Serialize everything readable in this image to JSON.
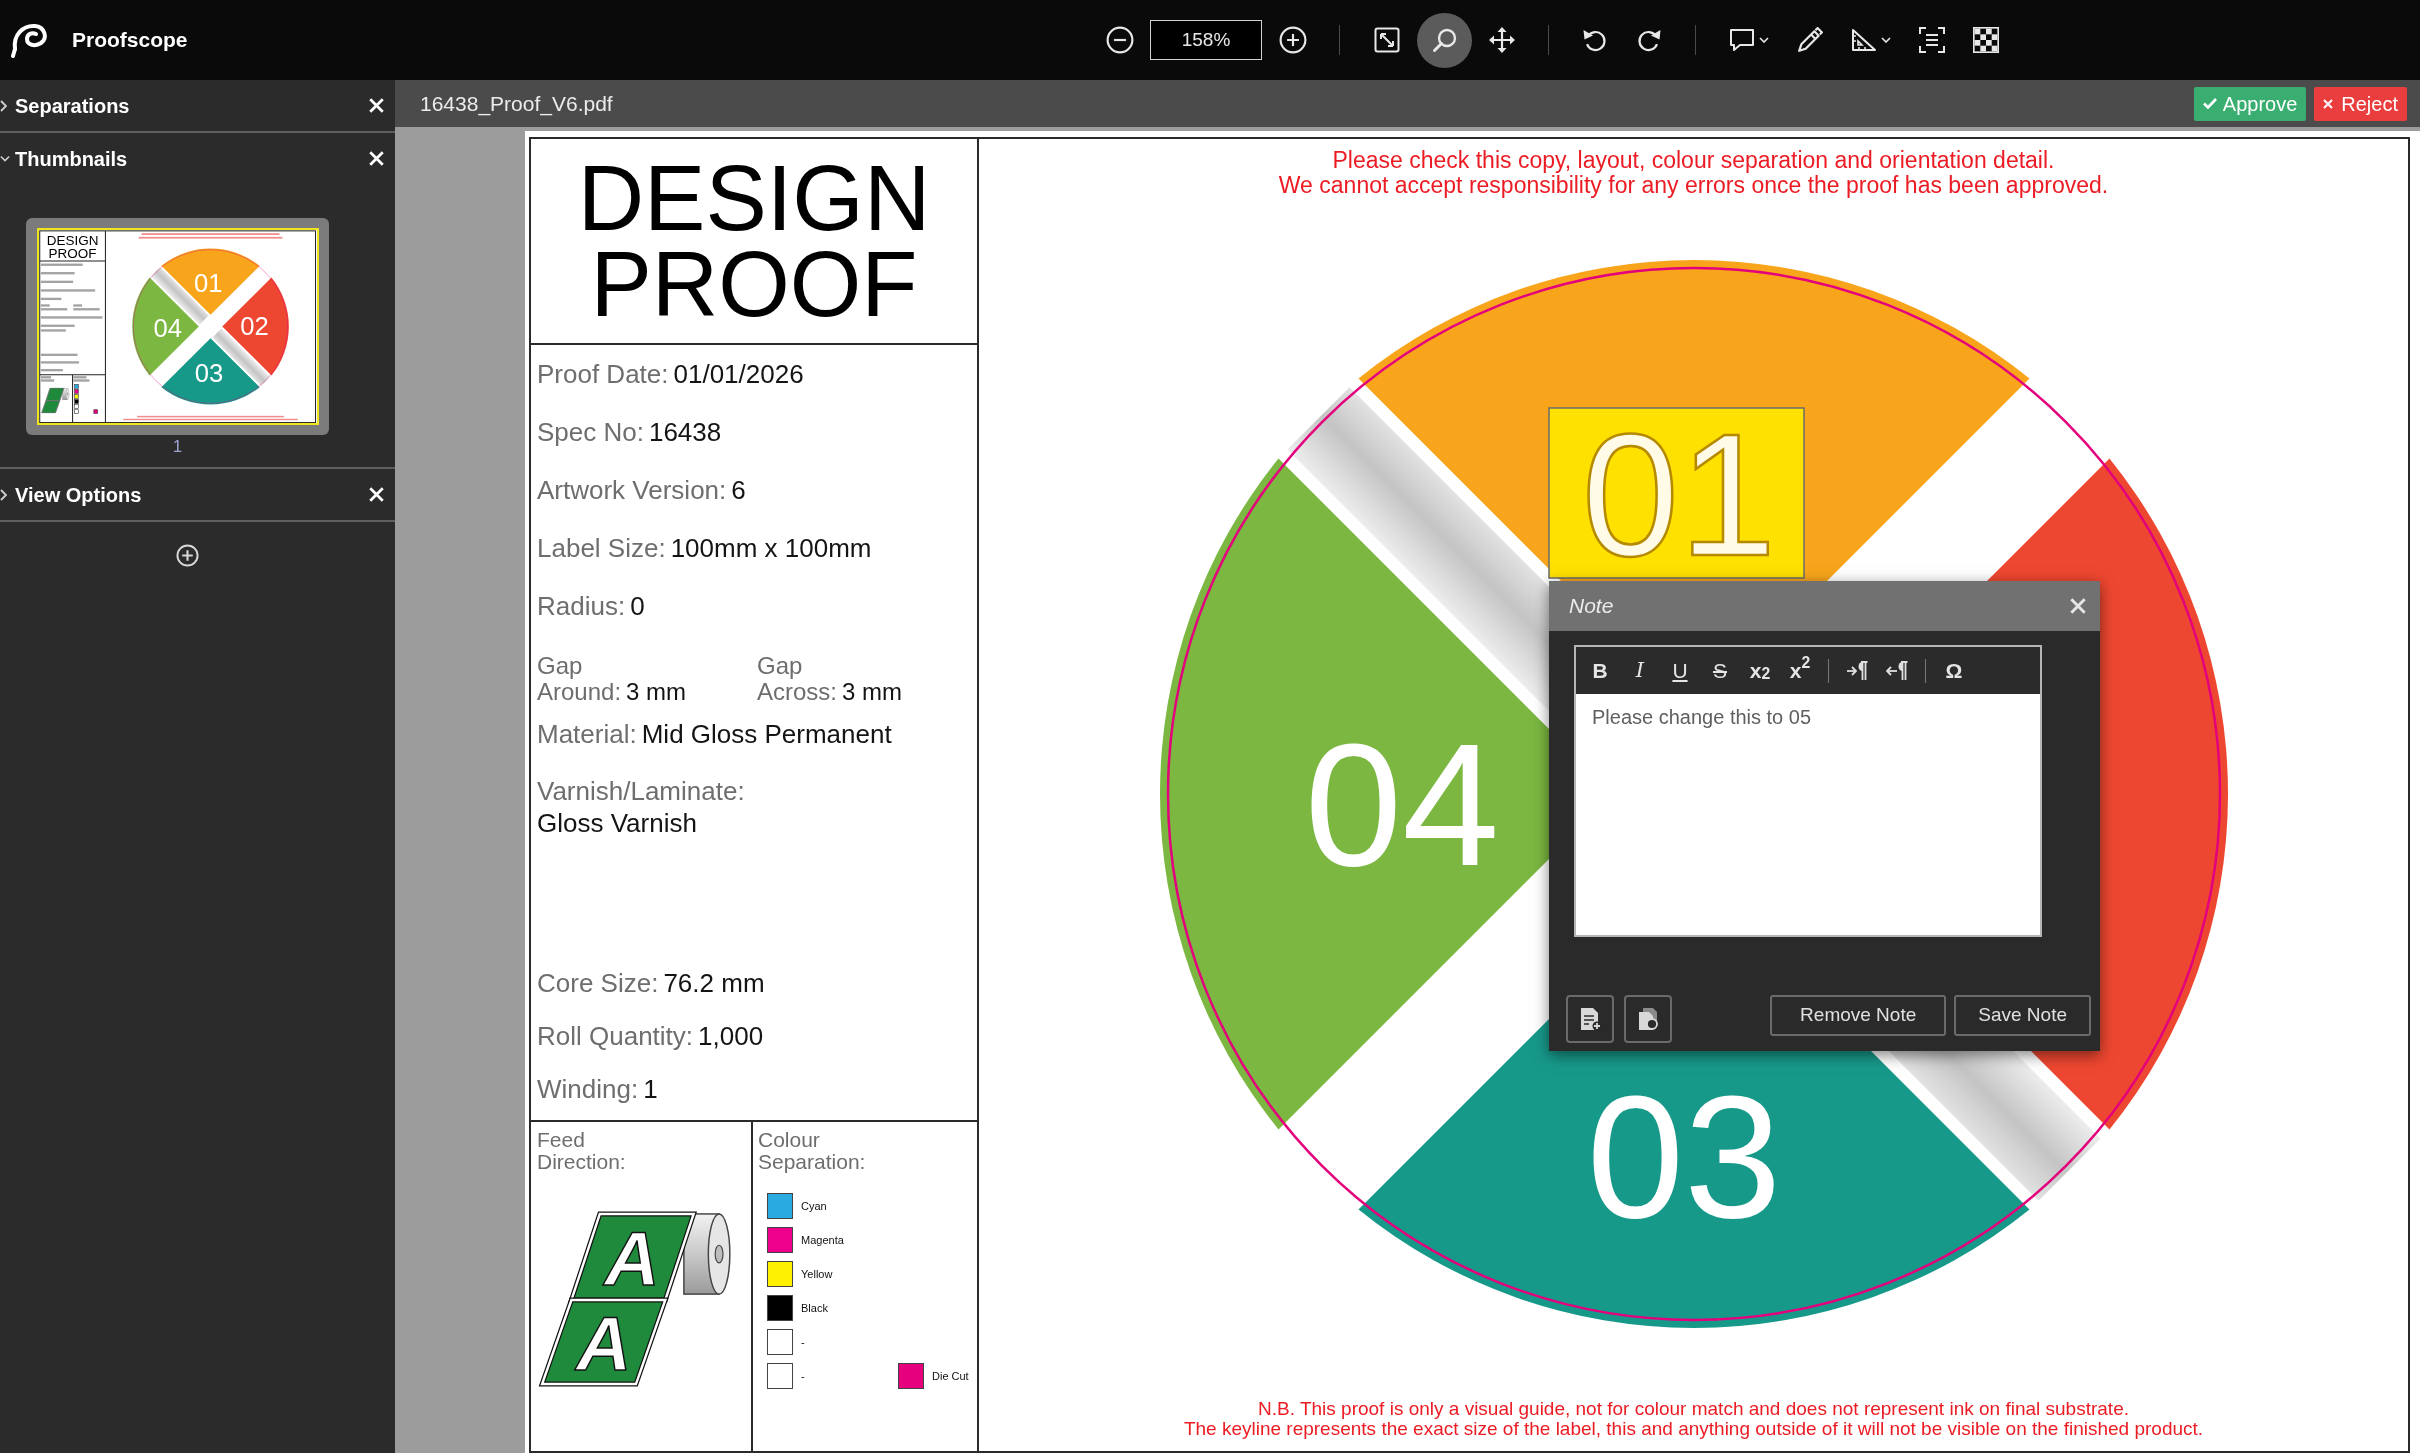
{
  "app": {
    "name": "Proofscope"
  },
  "toolbar": {
    "zoom_value": "158%",
    "tool_groups": [
      [
        {
          "selected": false,
          "dropdown": false
        },
        {
          "selected": true,
          "dropdown": false
        },
        {
          "selected": false,
          "dropdown": false
        }
      ],
      [
        {
          "selected": false,
          "dropdown": false
        },
        {
          "selected": false,
          "dropdown": false
        }
      ],
      [
        {
          "selected": false,
          "dropdown": true
        },
        {
          "selected": false,
          "dropdown": false
        },
        {
          "selected": false,
          "dropdown": true
        },
        {
          "selected": false,
          "dropdown": false
        },
        {
          "selected": false,
          "dropdown": false
        }
      ]
    ]
  },
  "sidebar": {
    "panels": [
      {
        "title": "Separations",
        "expanded": false
      },
      {
        "title": "Thumbnails",
        "expanded": true,
        "pages": [
          {
            "label": "1",
            "selected": true,
            "title": "DESIGN PROOF",
            "segments": [
              "01",
              "02",
              "03",
              "04"
            ]
          }
        ]
      },
      {
        "title": "View Options",
        "expanded": false
      }
    ]
  },
  "viewer": {
    "file_name": "16438_Proof_V6.pdf",
    "actions": [
      {
        "label": "Approve",
        "kind": "approve"
      },
      {
        "label": "Reject",
        "kind": "reject"
      }
    ]
  },
  "proof": {
    "title": "DESIGN PROOF",
    "details": [
      {
        "kind": "inline",
        "label": "Proof Date:",
        "value": "01/01/2026"
      },
      {
        "kind": "inline",
        "label": "Spec No:",
        "value": "16438"
      },
      {
        "kind": "inline",
        "label": "Artwork Version:",
        "value": "6"
      },
      {
        "kind": "inline",
        "label": "Label Size:",
        "value": "100mm x 100mm"
      },
      {
        "kind": "inline",
        "label": "Radius:",
        "value": "0"
      },
      {
        "kind": "pair",
        "items": [
          {
            "label": "Gap Around:",
            "value": "3 mm"
          },
          {
            "label": "Gap Across:",
            "value": "3 mm"
          }
        ]
      },
      {
        "kind": "inline",
        "label": "Material:",
        "value": "Mid Gloss Permanent"
      },
      {
        "kind": "stacked",
        "label": "Varnish/Laminate:",
        "value": "Gloss Varnish"
      }
    ],
    "roll_details": [
      {
        "kind": "inline",
        "label": "Core Size:",
        "value": "76.2 mm"
      },
      {
        "kind": "inline",
        "label": "Roll Quantity:",
        "value": "1,000"
      },
      {
        "kind": "inline",
        "label": "Winding:",
        "value": "1"
      }
    ],
    "feed_direction": {
      "label": "Feed Direction:",
      "letters": [
        "A",
        "A"
      ]
    },
    "colour_separation": {
      "label": "Colour Separation:",
      "inks": [
        {
          "name": "Cyan",
          "color": "#29abe2",
          "kind": "process"
        },
        {
          "name": "Magenta",
          "color": "#ec008c",
          "kind": "process"
        },
        {
          "name": "Yellow",
          "color": "#fff200",
          "kind": "process"
        },
        {
          "name": "Black",
          "color": "#000000",
          "kind": "process"
        },
        {
          "name": "-",
          "color": "#ffffff",
          "kind": "process"
        },
        {
          "name": "-",
          "color": "#ffffff",
          "kind": "process"
        },
        {
          "name": "Die Cut",
          "color": "#e6007e",
          "kind": "die-cut"
        }
      ]
    },
    "notice": [
      "Please check this copy, layout, colour separation and orientation detail.",
      "We cannot accept responsibility for any errors once the proof has been approved."
    ],
    "artwork": {
      "segments": [
        {
          "label": "01",
          "color": "#f8a51c",
          "highlighted": true
        },
        {
          "color": "#ee4731",
          "highlighted": false
        },
        {
          "label": "03",
          "color": "#17998a",
          "highlighted": false
        },
        {
          "label": "04",
          "color": "#7bb741",
          "highlighted": false
        }
      ]
    },
    "footer": [
      "N.B. This proof is only a visual guide, not for colour match and does not represent ink on final substrate.",
      "The keyline represents the exact size of the label, this and anything outside of it will not be visible on the finished product."
    ]
  },
  "note": {
    "title": "Note",
    "format_buttons": [
      {
        "kind": "bold",
        "label": "B"
      },
      {
        "kind": "italic",
        "label": "I"
      },
      {
        "kind": "underline",
        "label": "U"
      },
      {
        "kind": "strike",
        "label": "S"
      },
      {
        "kind": "subscript",
        "label": "x$_{2}$"
      },
      {
        "kind": "superscript",
        "label": "x$^{2}$"
      },
      {
        "kind": "divider"
      },
      {
        "kind": "ltr"
      },
      {
        "kind": "rtl"
      },
      {
        "kind": "divider"
      },
      {
        "kind": "symbol",
        "label": "Ω"
      }
    ],
    "text": "Please change this to 05",
    "actions": [
      {
        "kind": "notes-list"
      },
      {
        "kind": "attach"
      },
      {
        "kind": "remove",
        "label": "Remove Note"
      },
      {
        "kind": "save",
        "label": "Save Note"
      }
    ]
  }
}
